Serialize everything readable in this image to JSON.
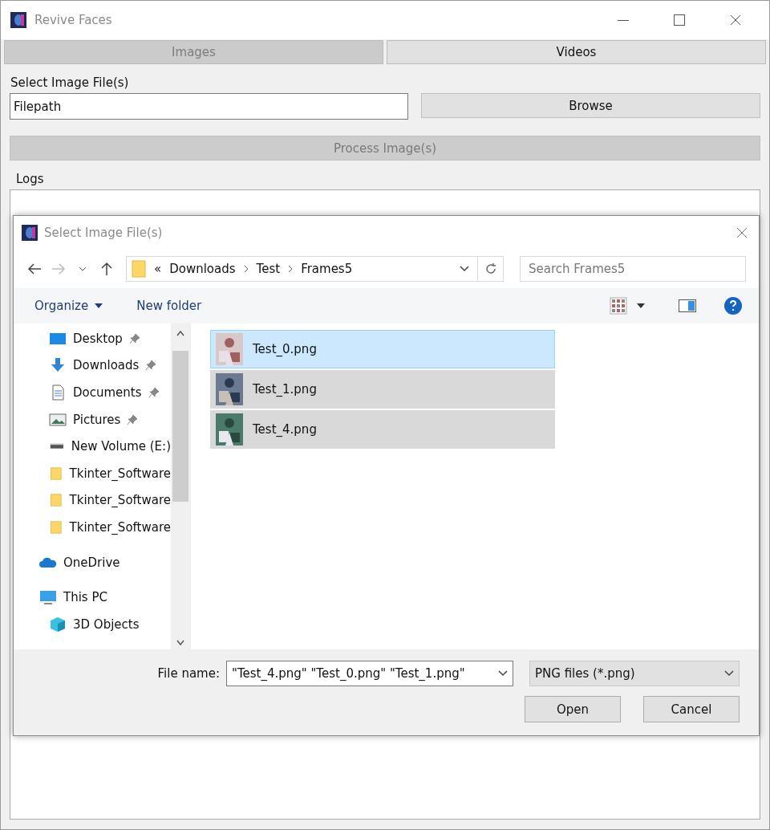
{
  "window": {
    "title": "Revive Faces"
  },
  "tabs": [
    {
      "label": "Images",
      "selected": true
    },
    {
      "label": "Videos",
      "selected": false
    }
  ],
  "select_label": "Select Image File(s)",
  "filepath": {
    "value": "Filepath"
  },
  "browse_button": "Browse",
  "process_button": {
    "label": "Process Image(s)",
    "disabled": true
  },
  "logs_label": "Logs",
  "dialog": {
    "title": "Select Image File(s)",
    "breadcrumb": [
      "«",
      "Downloads",
      "Test",
      "Frames5"
    ],
    "search": {
      "placeholder": "Search Frames5"
    },
    "toolbar": [
      "Organize",
      "New folder"
    ],
    "quick_access_items": [
      {
        "label": "Desktop",
        "kind": "desktop",
        "pinned": true
      },
      {
        "label": "Downloads",
        "kind": "downloads",
        "pinned": true
      },
      {
        "label": "Documents",
        "kind": "documents",
        "pinned": true
      },
      {
        "label": "Pictures",
        "kind": "pictures",
        "pinned": true
      },
      {
        "label": "New Volume (E:)",
        "kind": "drive",
        "pinned": false
      },
      {
        "label": "Tkinter_Software",
        "kind": "folder",
        "pinned": false
      },
      {
        "label": "Tkinter_Software",
        "kind": "folder",
        "pinned": false
      },
      {
        "label": "Tkinter_Software",
        "kind": "folder",
        "pinned": false
      }
    ],
    "roots": [
      {
        "label": "OneDrive",
        "kind": "cloud"
      },
      {
        "label": "This PC",
        "kind": "pc",
        "children": [
          {
            "label": "3D Objects",
            "kind": "cube"
          }
        ]
      }
    ],
    "files": [
      {
        "name": "Test_0.png",
        "selected": true,
        "focused": true
      },
      {
        "name": "Test_1.png",
        "selected": true,
        "focused": false
      },
      {
        "name": "Test_4.png",
        "selected": true,
        "focused": false
      }
    ],
    "file_name_label": "File name:",
    "file_name": {
      "value": "\"Test_4.png\" \"Test_0.png\" \"Test_1.png\""
    },
    "file_type": "PNG files (*.png)",
    "buttons": [
      "Open",
      "Cancel"
    ]
  }
}
